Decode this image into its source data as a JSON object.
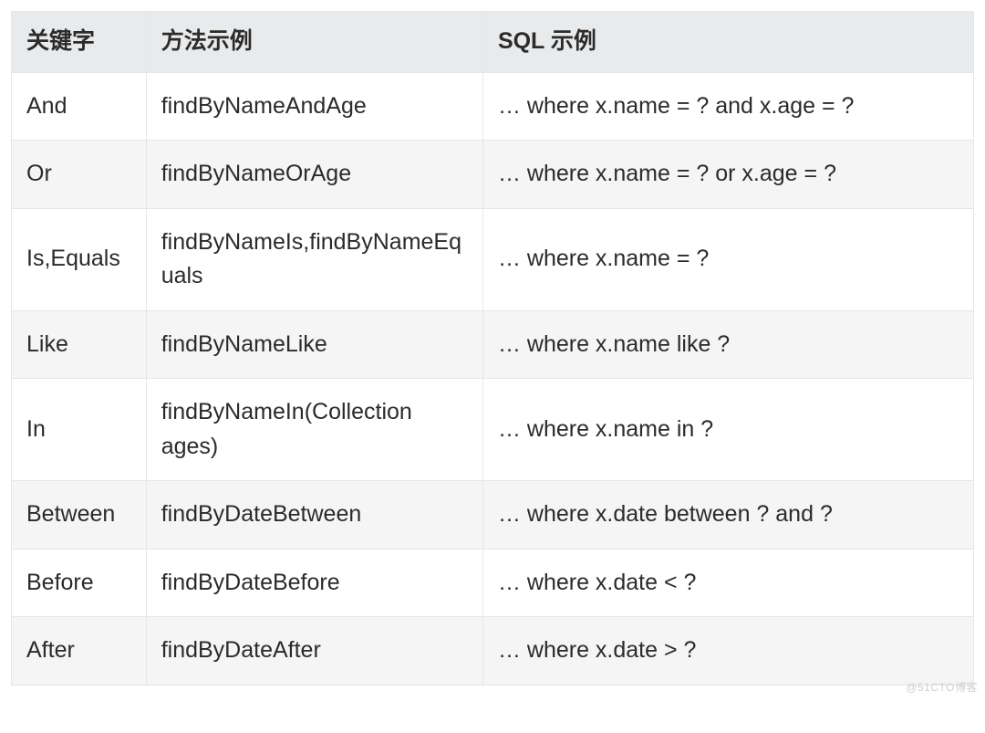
{
  "table": {
    "headers": [
      "关键字",
      "方法示例",
      "SQL 示例"
    ],
    "rows": [
      {
        "keyword": "And",
        "method": "findByNameAndAge",
        "sql": "… where x.name = ? and x.age = ?"
      },
      {
        "keyword": "Or",
        "method": "findByNameOrAge",
        "sql": "… where x.name = ? or x.age = ?"
      },
      {
        "keyword": "Is,Equals",
        "method": "findByNameIs,findByNameEquals",
        "sql": "… where x.name = ?"
      },
      {
        "keyword": "Like",
        "method": "findByNameLike",
        "sql": "… where x.name like ?"
      },
      {
        "keyword": "In",
        "method": "findByNameIn(Collection ages)",
        "sql": "… where x.name in ?"
      },
      {
        "keyword": "Between",
        "method": "findByDateBetween",
        "sql": "… where x.date between ? and ?"
      },
      {
        "keyword": "Before",
        "method": "findByDateBefore",
        "sql": "… where x.date < ?"
      },
      {
        "keyword": "After",
        "method": "findByDateAfter",
        "sql": "… where x.date > ?"
      }
    ]
  },
  "watermark": "@51CTO博客"
}
